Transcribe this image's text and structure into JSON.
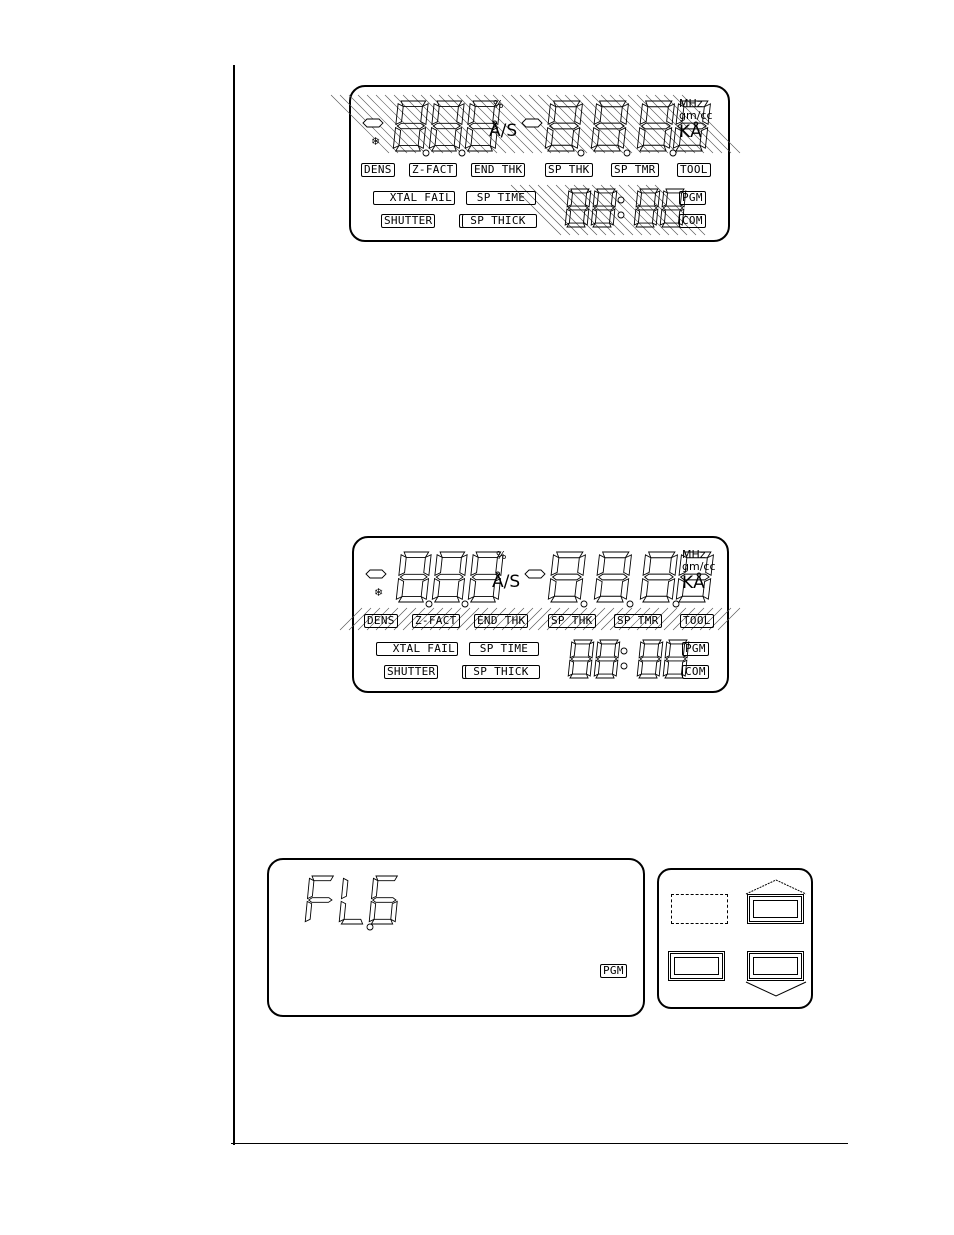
{
  "page": {
    "figures": [
      {
        "id": "display-all-segments-hatched-digits",
        "rate_display": "8.8.8",
        "thickness_display": "8.8.8.8",
        "time_display": "88:88",
        "rate_units": [
          "%",
          "Å/S"
        ],
        "thickness_units": [
          "MHz",
          "gm/cc",
          "KÅ"
        ],
        "annunciators_row1": [
          "DENS",
          "Z-FACT",
          "END THK",
          "SP THK",
          "SP TMR",
          "TOOL"
        ],
        "annunciators_row2": [
          "XTAL FAIL",
          "SP TIME",
          "PGM"
        ],
        "annunciators_row3": [
          "SHUTTER",
          "SP THICK",
          "COM"
        ],
        "highlighted": "digits"
      },
      {
        "id": "display-annunciators-hatched",
        "rate_display": "8.8.8",
        "thickness_display": "8.8.8.8",
        "time_display": "88:88",
        "rate_units": [
          "%",
          "Å/S"
        ],
        "thickness_units": [
          "MHz",
          "gm/cc",
          "KÅ"
        ],
        "annunciators_row1": [
          "DENS",
          "Z-FACT",
          "END THK",
          "SP THK",
          "SP TMR",
          "TOOL"
        ],
        "annunciators_row2": [
          "XTAL FAIL",
          "SP TIME",
          "PGM"
        ],
        "annunciators_row3": [
          "SHUTTER",
          "SP THICK",
          "COM"
        ],
        "highlighted": "annunciators"
      },
      {
        "id": "display-program-mode",
        "main_display": "FL.6",
        "annunciator": "PGM"
      }
    ],
    "keypad": {
      "keys": [
        "blank-key",
        "up-key",
        "left-key",
        "down-key"
      ]
    }
  }
}
